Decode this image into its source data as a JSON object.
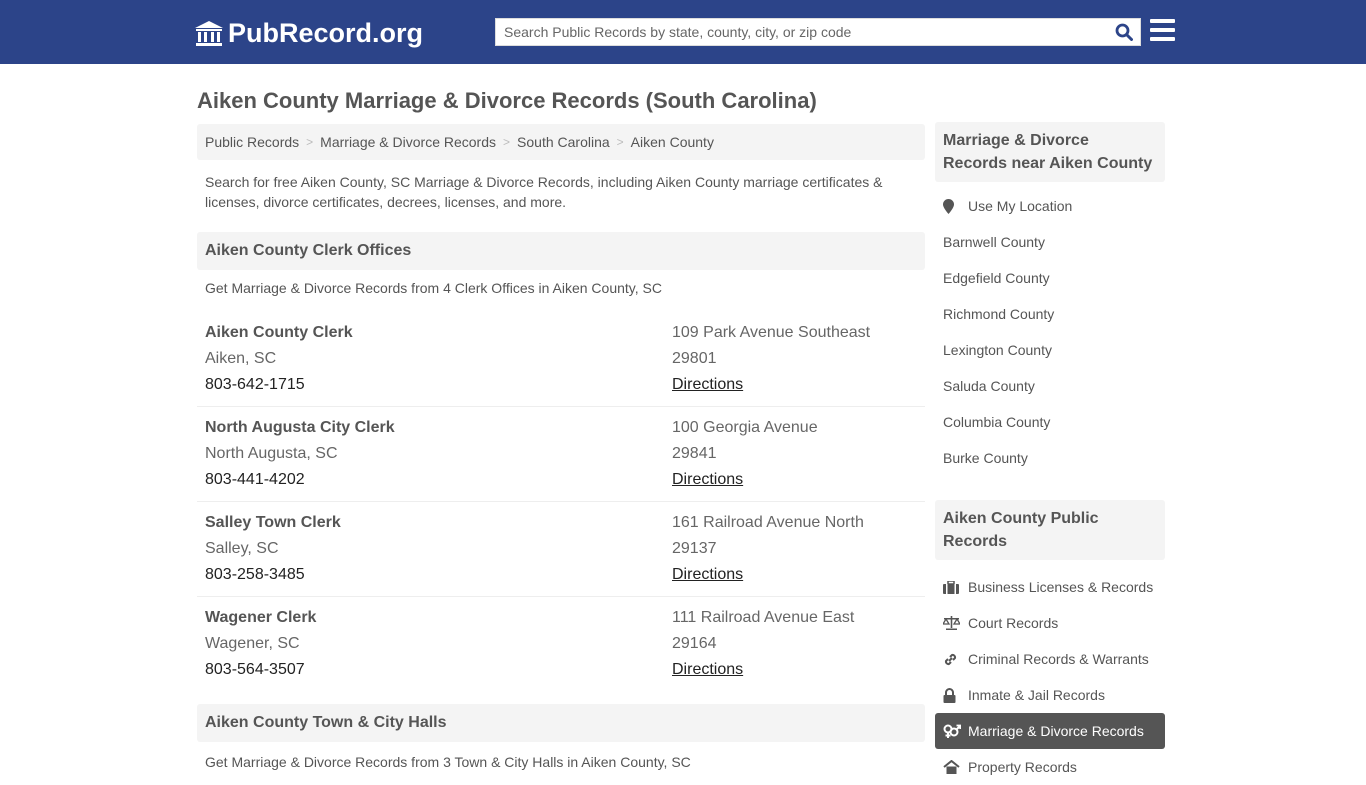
{
  "header": {
    "logo_text": "PubRecord.org",
    "search_placeholder": "Search Public Records by state, county, city, or zip code",
    "brand_color": "#2c4489"
  },
  "page_title": "Aiken County Marriage & Divorce Records (South Carolina)",
  "breadcrumb": [
    {
      "label": "Public Records"
    },
    {
      "label": "Marriage & Divorce Records"
    },
    {
      "label": "South Carolina"
    },
    {
      "label": "Aiken County"
    }
  ],
  "intro": "Search for free Aiken County, SC Marriage & Divorce Records, including Aiken County marriage certificates & licenses, divorce certificates, decrees, licenses, and more.",
  "clerk_section": {
    "title": "Aiken County Clerk Offices",
    "subtitle": "Get Marriage & Divorce Records from 4 Clerk Offices in Aiken County, SC",
    "offices": [
      {
        "name": "Aiken County Clerk",
        "city": "Aiken, SC",
        "phone": "803-642-1715",
        "address": "109 Park Avenue Southeast",
        "zip": "29801",
        "directions": "Directions"
      },
      {
        "name": "North Augusta City Clerk",
        "city": "North Augusta, SC",
        "phone": "803-441-4202",
        "address": "100 Georgia Avenue",
        "zip": "29841",
        "directions": "Directions"
      },
      {
        "name": "Salley Town Clerk",
        "city": "Salley, SC",
        "phone": "803-258-3485",
        "address": "161 Railroad Avenue North",
        "zip": "29137",
        "directions": "Directions"
      },
      {
        "name": "Wagener Clerk",
        "city": "Wagener, SC",
        "phone": "803-564-3507",
        "address": "111 Railroad Avenue East",
        "zip": "29164",
        "directions": "Directions"
      }
    ]
  },
  "townhall_section": {
    "title": "Aiken County Town & City Halls",
    "subtitle": "Get Marriage & Divorce Records from 3 Town & City Halls in Aiken County, SC"
  },
  "sidebar": {
    "nearby": {
      "title": "Marriage & Divorce Records near Aiken County",
      "use_location": "Use My Location",
      "counties": [
        "Barnwell County",
        "Edgefield County",
        "Richmond County",
        "Lexington County",
        "Saluda County",
        "Columbia County",
        "Burke County"
      ]
    },
    "public_records": {
      "title": "Aiken County Public Records",
      "items": [
        {
          "label": "Business Licenses & Records",
          "icon": "briefcase-icon"
        },
        {
          "label": "Court Records",
          "icon": "scales-icon"
        },
        {
          "label": "Criminal Records & Warrants",
          "icon": "link-icon"
        },
        {
          "label": "Inmate & Jail Records",
          "icon": "lock-icon"
        },
        {
          "label": "Marriage & Divorce Records",
          "icon": "gender-icon",
          "active": true
        },
        {
          "label": "Property Records",
          "icon": "home-icon"
        }
      ]
    }
  }
}
